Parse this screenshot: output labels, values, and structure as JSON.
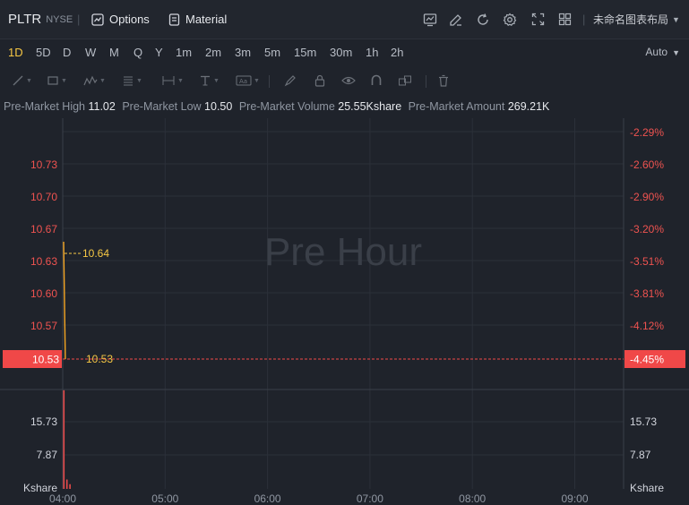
{
  "header": {
    "symbol": "PLTR",
    "exchange": "NYSE",
    "options_label": "Options",
    "material_label": "Material",
    "layout_label": "未命名图表布局"
  },
  "intervals": [
    "1D",
    "5D",
    "D",
    "W",
    "M",
    "Q",
    "Y",
    "1m",
    "2m",
    "3m",
    "5m",
    "15m",
    "30m",
    "1h",
    "2h"
  ],
  "active_interval": "1D",
  "scale_mode": "Auto",
  "stats": [
    {
      "label": "Pre-Market High",
      "value": "11.02"
    },
    {
      "label": "Pre-Market Low",
      "value": "10.50"
    },
    {
      "label": "Pre-Market Volume",
      "value": "25.55Kshare"
    },
    {
      "label": "Pre-Market Amount",
      "value": "269.21K"
    }
  ],
  "watermark": "Pre Hour",
  "chart_data": {
    "type": "line",
    "session": "pre-market",
    "x_labels": [
      "04:00",
      "05:00",
      "06:00",
      "07:00",
      "08:00",
      "09:00"
    ],
    "price_axis": {
      "ticks": [
        "10.73",
        "10.70",
        "10.67",
        "10.63",
        "10.60",
        "10.57"
      ],
      "pct_ticks": [
        "-2.29%",
        "-2.60%",
        "-2.90%",
        "-3.20%",
        "-3.51%",
        "-3.81%",
        "-4.12%"
      ],
      "current": "10.53",
      "current_pct": "-4.45%"
    },
    "price_series": [
      {
        "time": "04:00",
        "price": 10.65
      },
      {
        "time": "04:01",
        "price": 10.53
      }
    ],
    "price_markers": [
      {
        "label": "10.64",
        "price": 10.64
      },
      {
        "label": "10.53",
        "price": 10.53
      }
    ],
    "volume_axis": {
      "ticks": [
        "15.73",
        "7.87"
      ],
      "unit": "Kshare"
    },
    "volume_series": [
      {
        "time": "04:00",
        "volume": 21
      },
      {
        "time": "04:01",
        "volume": 2
      },
      {
        "time": "04:02",
        "volume": 1
      }
    ],
    "colors": {
      "background": "#1f232b",
      "grid": "#2b3039",
      "price_line": "#f5a623",
      "marker": "#f6c744",
      "current_line": "#f04848",
      "volume_bar": "#e84a4a",
      "down_text": "#ef5350"
    }
  }
}
